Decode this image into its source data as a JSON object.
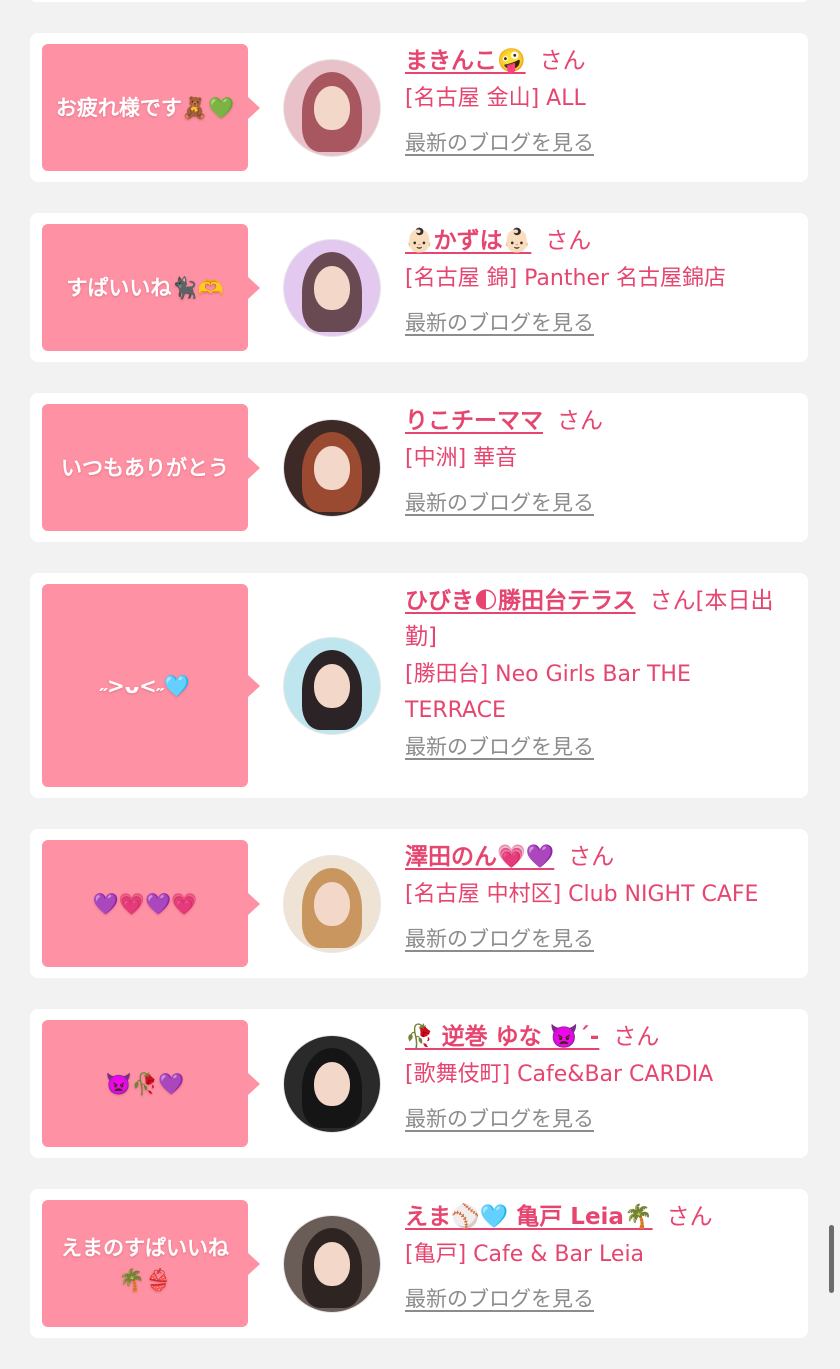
{
  "cards": [
    {
      "message": "お疲れ様です🧸💚",
      "name": "まきんこ🤪",
      "honorific": "さん",
      "shop": "[名古屋 金山] ALL",
      "blog_link": "最新のブログを見る"
    },
    {
      "message": "すぱいいね🐈‍⬛🫶",
      "name": "👶🏻かずは👶🏻",
      "honorific": "さん",
      "shop": "[名古屋 錦] Panther 名古屋錦店",
      "blog_link": "最新のブログを見る"
    },
    {
      "message": "いつもありがとう",
      "name": "りこチーママ",
      "honorific": "さん",
      "shop": "[中洲] 華音",
      "blog_link": "最新のブログを見る"
    },
    {
      "message": "˶>ᴗ<˶🩵",
      "name": "ひびき🌓勝田台テラス",
      "honorific": "さん[本日出勤]",
      "shop": "[勝田台] Neo Girls Bar THE TERRACE",
      "blog_link": "最新のブログを見る"
    },
    {
      "message": "💜💗💜💗",
      "name": "澤田のん💗💜",
      "honorific": "さん",
      "shop": "[名古屋 中村区] Club NIGHT CAFE",
      "blog_link": "最新のブログを見る"
    },
    {
      "message": "👿🥀💜",
      "name": "🥀 逆巻 ゆな 👿ˊ-",
      "honorific": "さん",
      "shop": "[歌舞伎町] Cafe&Bar CARDIA",
      "blog_link": "最新のブログを見る"
    },
    {
      "message": "えまのすぱいいね🌴👙",
      "name": "えま⚾🩵 亀戸 Leia🌴",
      "honorific": "さん",
      "shop": "[亀戸] Cafe & Bar Leia",
      "blog_link": "最新のブログを見る"
    }
  ],
  "avatar_colors": [
    "#c46a72",
    "#d9b3e6",
    "#7a4a3a",
    "#9fd6e8",
    "#d8a777",
    "#3a3a3a",
    "#5a4e4a"
  ]
}
